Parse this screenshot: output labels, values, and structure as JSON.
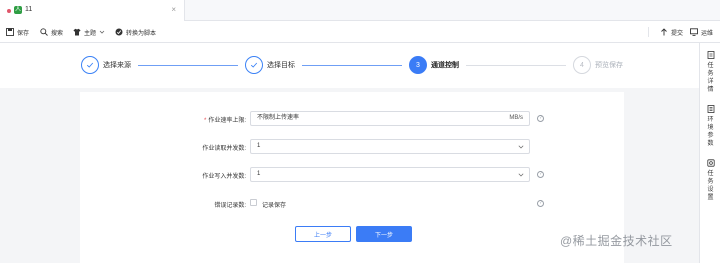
{
  "tab": {
    "icon_text": "人",
    "title": "11",
    "close": "×"
  },
  "toolbar": {
    "save": "保存",
    "search": "搜索",
    "theme": "主题",
    "convert": "转换为脚本",
    "submit": "提交",
    "ops": "运维"
  },
  "steps": [
    {
      "index": "1",
      "label": "选择来源",
      "status": "done"
    },
    {
      "index": "2",
      "label": "选择目标",
      "status": "done"
    },
    {
      "index": "3",
      "label": "通道控制",
      "status": "active"
    },
    {
      "index": "4",
      "label": "预览保存",
      "status": "todo"
    }
  ],
  "form": {
    "rate_label": "作业速率上限:",
    "rate_value": "不限制上传速率",
    "rate_unit": "MB/s",
    "read_label": "作业读取并发数:",
    "read_value": "1",
    "write_label": "作业写入并发数:",
    "write_value": "1",
    "error_label": "错误记录数:",
    "error_checkbox_label": "记录保存",
    "help_glyph": "?"
  },
  "buttons": {
    "prev": "上一步",
    "next": "下一步"
  },
  "right_panel": {
    "task_details": "任务详情",
    "env_params": "环境参数",
    "task_settings": "任务设置"
  },
  "watermark": "@稀土掘金技术社区",
  "colors": {
    "primary": "#3b7cf6",
    "required": "#e5484d",
    "tab_dot": "#e0566a",
    "tab_icon": "#2f9e44"
  }
}
